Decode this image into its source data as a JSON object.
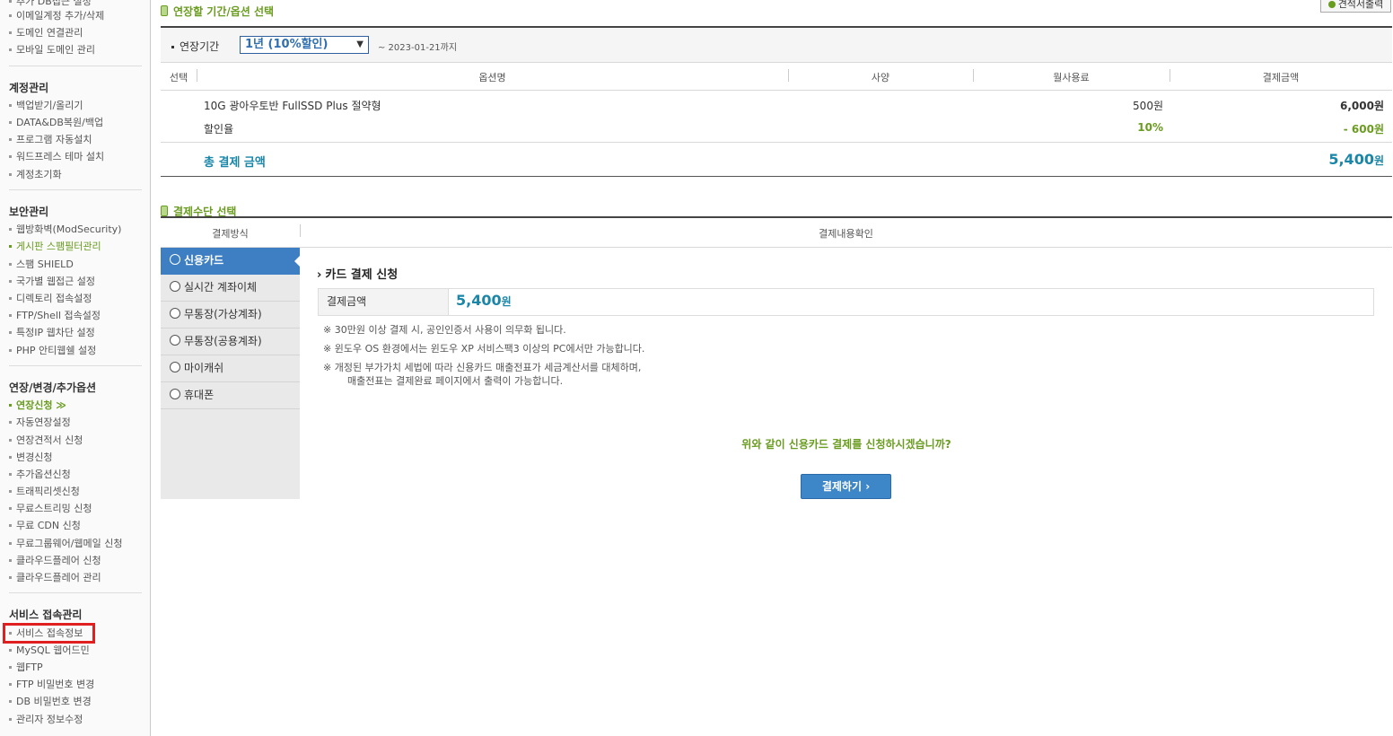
{
  "sidebar": {
    "top_items": [
      "추가 DB접근 설정",
      "이메일계정 추가/삭제",
      "도메인 연결관리",
      "모바일 도메인 관리"
    ],
    "account": {
      "title": "계정관리",
      "items": [
        "백업받기/올리기",
        "DATA&DB복원/백업",
        "프로그램 자동설치",
        "워드프레스 테마 설치",
        "계정초기화"
      ]
    },
    "security": {
      "title": "보안관리",
      "items": [
        "웹방화벽(ModSecurity)",
        "게시판 스팸필터관리",
        "스팸 SHIELD",
        "국가별 웹접근 설정",
        "디렉토리 접속설정",
        "FTP/Shell 접속설정",
        "특정IP 웹차단 설정",
        "PHP 안티웹쉘 설정"
      ]
    },
    "extend": {
      "title": "연장/변경/추가옵션",
      "items": [
        "연장신청 ≫",
        "자동연장설정",
        "연장견적서 신청",
        "변경신청",
        "추가옵션신청",
        "트래픽리셋신청",
        "무료스트리밍 신청",
        "무료 CDN 신청",
        "무료그룹웨어/웹메일 신청",
        "클라우드플레어 신청",
        "클라우드플레어 관리"
      ]
    },
    "service": {
      "title": "서비스 접속관리",
      "items": [
        "서비스 접속정보",
        "MySQL 웹어드민",
        "웹FTP",
        "FTP 비밀번호 변경",
        "DB 비밀번호 변경",
        "관리자 정보수정"
      ]
    }
  },
  "period_section": {
    "title": "연장할 기간/옵션 선택",
    "print_button": "견적서출력",
    "period_label": "연장기간",
    "period_value": "1년 (10%할인)",
    "period_until": "~ 2023-01-21까지",
    "headers": [
      "선택",
      "옵션명",
      "사양",
      "월사용료",
      "결제금액"
    ],
    "rows": [
      {
        "name": "10G 광아우토반 FullSSD Plus 절약형",
        "monthly": "500원",
        "amount": "6,000원"
      },
      {
        "name": "할인율",
        "monthly": "10%",
        "amount": "- 600원"
      }
    ],
    "total_label": "총 결제 금액",
    "total_value": "5,400",
    "total_unit": "원"
  },
  "payment_section": {
    "title": "결제수단 선택",
    "headers": [
      "결제방식",
      "결제내용확인"
    ],
    "methods": [
      "신용카드",
      "실시간 계좌이체",
      "무통장(가상계좌)",
      "무통장(공용계좌)",
      "마이캐쉬",
      "휴대폰"
    ],
    "card_title": "카드 결제 신청",
    "amount_label": "결제금액",
    "amount_value": "5,400",
    "amount_unit": "원",
    "notes": [
      "※ 30만원 이상 결제 시, 공인인증서 사용이 의무화 됩니다.",
      "※ 윈도우 OS 환경에서는 윈도우 XP 서비스팩3 이상의 PC에서만 가능합니다.",
      "※ 개정된 부가가치 세법에 따라 신용카드 매출전표가 세금계산서를 대체하며,",
      "매출전표는 결제완료 페이지에서 출력이 가능합니다."
    ],
    "question": "위와 같이 신용카드 결제를 신청하시겠습니까?",
    "submit_label": "결제하기"
  },
  "colors": {
    "accent_green": "#6a9c1f",
    "accent_blue": "#1a86a8",
    "button_blue": "#3d86c8",
    "highlight_red": "#e02020"
  }
}
